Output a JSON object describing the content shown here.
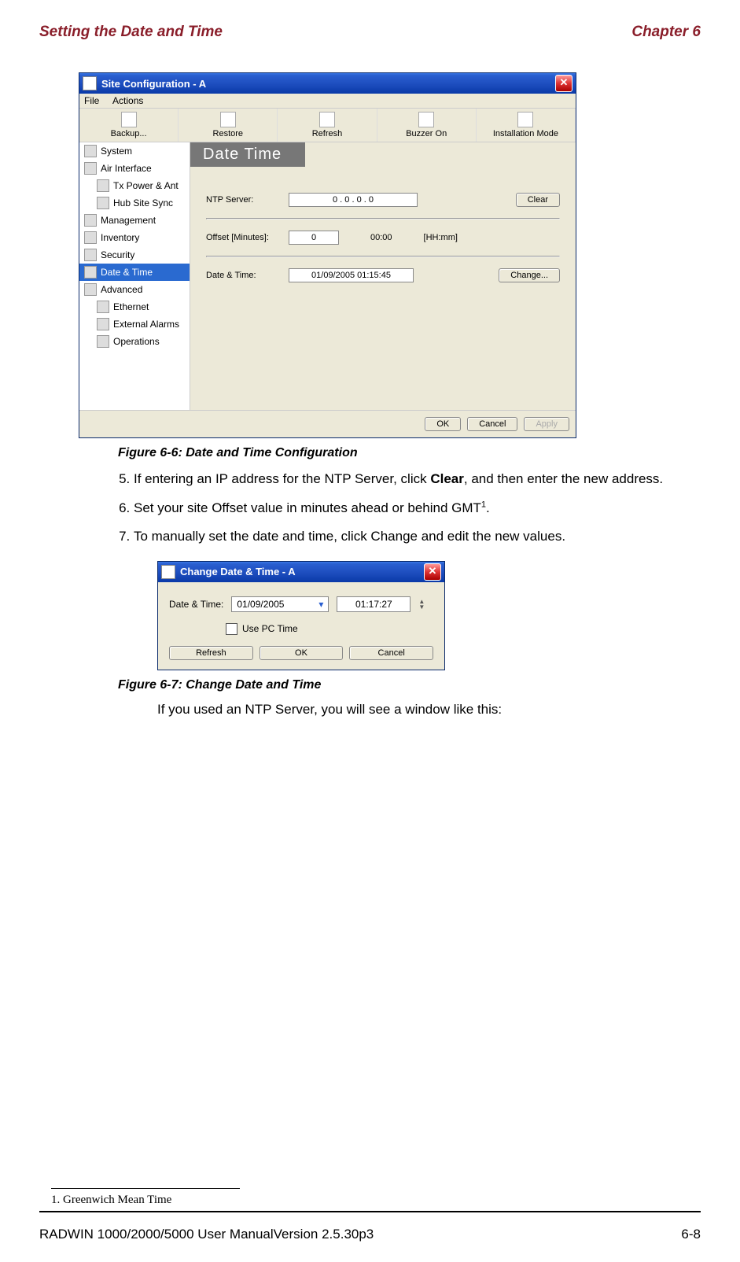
{
  "header": {
    "left": "Setting the Date and Time",
    "right": "Chapter 6"
  },
  "window1": {
    "title": "Site Configuration - A",
    "menu": {
      "file": "File",
      "actions": "Actions"
    },
    "toolbar": [
      "Backup...",
      "Restore",
      "Refresh",
      "Buzzer On",
      "Installation Mode"
    ],
    "sidebar": {
      "items": [
        "System",
        "Air Interface",
        "Tx Power & Ant",
        "Hub Site Sync",
        "Management",
        "Inventory",
        "Security",
        "Date & Time",
        "Advanced",
        "Ethernet",
        "External Alarms",
        "Operations"
      ],
      "selected_index": 7
    },
    "panel_title": "Date  Time",
    "ntp_label": "NTP Server:",
    "ntp_value": "0  .  0  .  0  .  0",
    "clear": "Clear",
    "offset_label": "Offset [Minutes]:",
    "offset_value": "0",
    "offset_time": "00:00",
    "offset_unit": "[HH:mm]",
    "dt_label": "Date & Time:",
    "dt_value": "01/09/2005 01:15:45",
    "change": "Change...",
    "ok": "OK",
    "cancel": "Cancel",
    "apply": "Apply"
  },
  "figure1_caption": "Figure 6-6: Date and Time Configuration",
  "step5_a": "If entering an IP address for the NTP Server, click ",
  "step5_b": "Clear",
  "step5_c": ", and then enter the new address.",
  "step6_a": "Set your site Offset value in minutes ahead or behind GMT",
  "step6_b": ".",
  "step7": "To manually set the date and time, click Change and edit the new values.",
  "window2": {
    "title": "Change Date & Time - A",
    "dt_label": "Date & Time:",
    "date_value": "01/09/2005",
    "time_value": "01:17:27",
    "use_pc": "Use PC Time",
    "refresh": "Refresh",
    "ok": "OK",
    "cancel": "Cancel"
  },
  "figure2_caption": "Figure 6-7: Change Date and Time",
  "after_fig2": "If you used an NTP Server, you will see a window like this:",
  "footnote": "1. Greenwich Mean Time",
  "footer": {
    "left": "RADWIN 1000/2000/5000 User ManualVersion  2.5.30p3",
    "right": "6-8"
  }
}
